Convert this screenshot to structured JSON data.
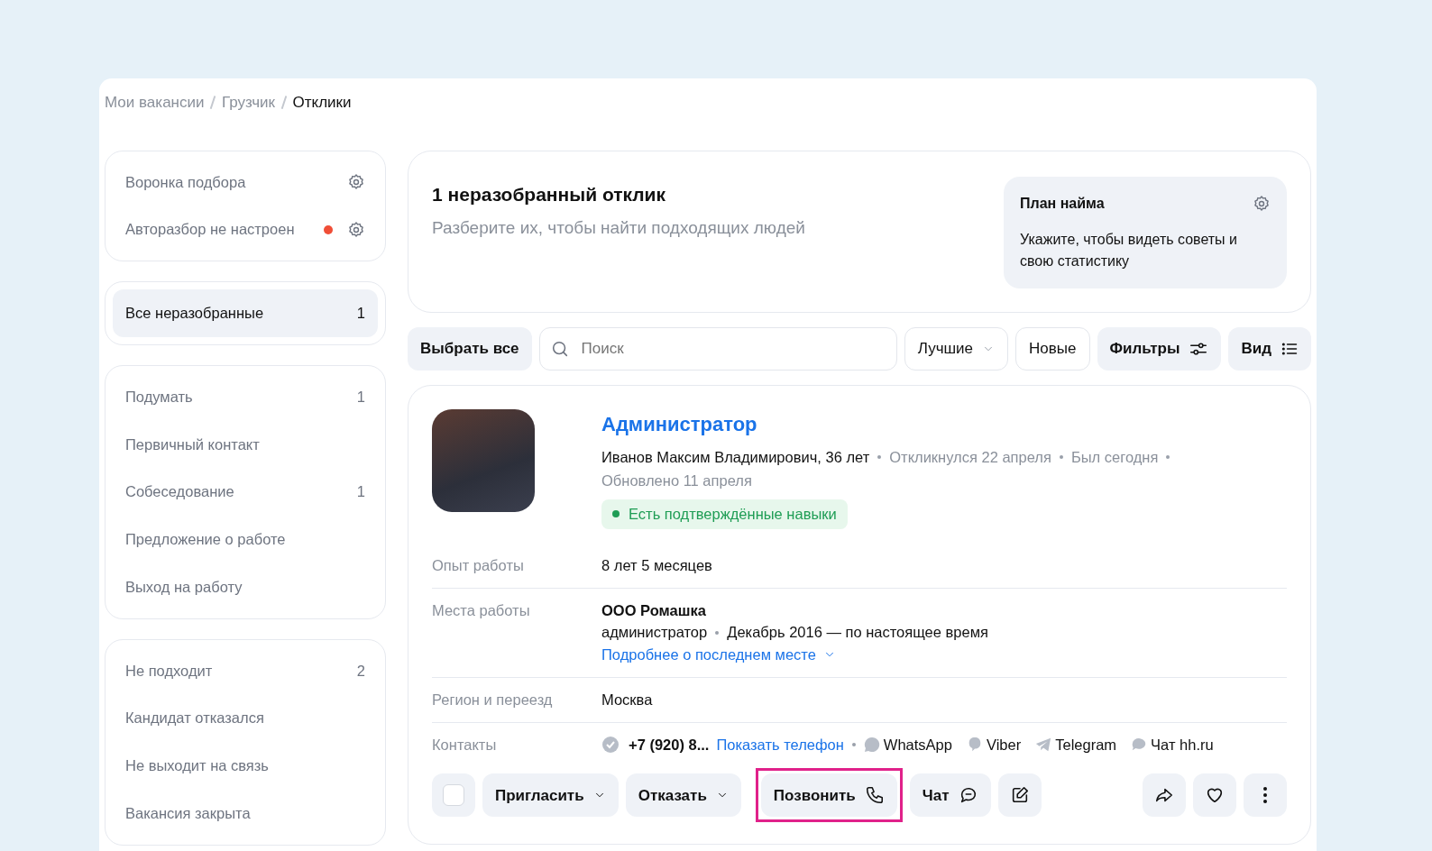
{
  "breadcrumbs": [
    {
      "label": "Мои вакансии",
      "current": false
    },
    {
      "label": "Грузчик",
      "current": false
    },
    {
      "label": "Отклики",
      "current": true
    }
  ],
  "sidebar": {
    "settings": [
      {
        "label": "Воронка подбора",
        "alert": false
      },
      {
        "label": "Авторазбор не настроен",
        "alert": true
      }
    ],
    "groups": [
      [
        {
          "label": "Все неразобранные",
          "count": "1",
          "selected": true
        }
      ],
      [
        {
          "label": "Подумать",
          "count": "1",
          "selected": false
        },
        {
          "label": "Первичный контакт",
          "selected": false
        },
        {
          "label": "Собеседование",
          "count": "1",
          "selected": false
        },
        {
          "label": "Предложение о работе",
          "selected": false
        },
        {
          "label": "Выход на работу",
          "selected": false
        }
      ],
      [
        {
          "label": "Не подходит",
          "count": "2",
          "selected": false
        },
        {
          "label": "Кандидат отказался",
          "selected": false
        },
        {
          "label": "Не выходит на связь",
          "selected": false
        },
        {
          "label": "Вакансия закрыта",
          "selected": false
        }
      ]
    ]
  },
  "summary": {
    "title": "1 неразобранный отклик",
    "subtitle": "Разберите их, чтобы найти подходящих людей"
  },
  "plan": {
    "title": "План найма",
    "text": "Укажите, чтобы видеть советы и свою статистику"
  },
  "toolbar": {
    "select_all": "Выбрать все",
    "search": {
      "placeholder": "Поиск"
    },
    "sort": "Лучшие",
    "new": "Новые",
    "filters": "Фильтры",
    "view": "Вид"
  },
  "candidate": {
    "position": "Администратор",
    "name": "Иванов Максим Владимирович, 36 лет",
    "meta": [
      "Откликнулся 22 апреля",
      "Был сегодня",
      "Обновлено 11 апреля"
    ],
    "badge": "Есть подтверждённые навыки",
    "rows": [
      {
        "label": "Опыт работы",
        "kind": "text",
        "value": "8 лет 5 месяцев"
      },
      {
        "label": "Места работы",
        "kind": "job",
        "company": "ООО Ромашка",
        "role": "администратор",
        "period": "Декабрь 2016 — по настоящее время",
        "more": "Подробнее о последнем месте"
      },
      {
        "label": "Регион и переезд",
        "kind": "text",
        "value": "Москва"
      },
      {
        "label": "Контакты",
        "kind": "contacts",
        "phone": "+7 (920) 8...",
        "show_phone": "Показать телефон",
        "messengers": [
          {
            "kind": "whatsapp",
            "label": "WhatsApp"
          },
          {
            "kind": "viber",
            "label": "Viber"
          },
          {
            "kind": "telegram",
            "label": "Telegram"
          },
          {
            "kind": "chat",
            "label": "Чат hh.ru"
          }
        ]
      }
    ],
    "actions": [
      {
        "kind": "checkbox",
        "checked": false
      },
      {
        "kind": "dropdown",
        "label": "Пригласить",
        "highlighted": false
      },
      {
        "kind": "dropdown",
        "label": "Отказать",
        "highlighted": false
      },
      {
        "kind": "call",
        "label": "Позвонить",
        "highlighted": true
      },
      {
        "kind": "chat",
        "label": "Чат",
        "highlighted": false
      },
      {
        "kind": "edit"
      },
      {
        "kind": "spacer"
      },
      {
        "kind": "share"
      },
      {
        "kind": "favorite"
      },
      {
        "kind": "more"
      }
    ]
  }
}
